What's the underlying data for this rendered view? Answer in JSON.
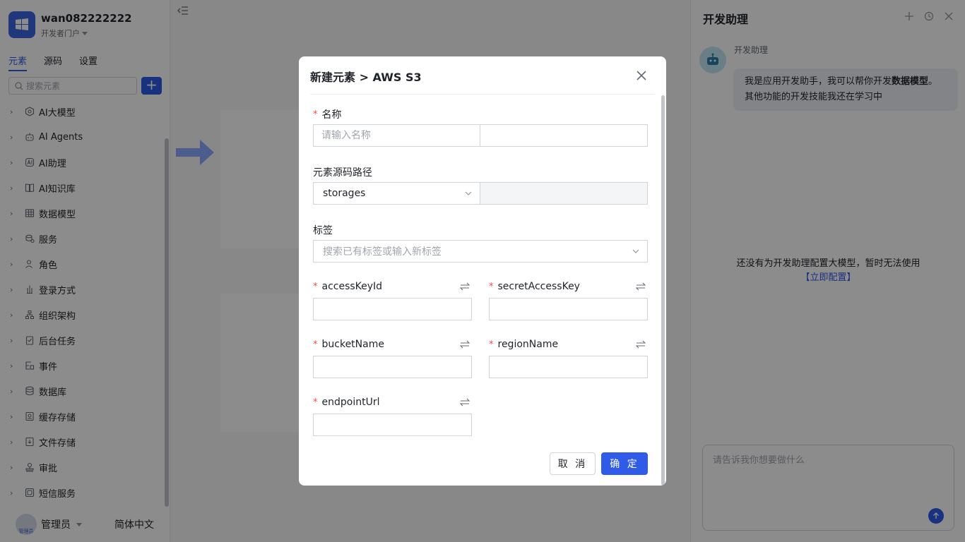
{
  "app": {
    "name": "wan082222222",
    "portal": "开发者门户"
  },
  "sidebar": {
    "tabs": [
      {
        "label": "元素",
        "active": true
      },
      {
        "label": "源码",
        "active": false
      },
      {
        "label": "设置",
        "active": false
      }
    ],
    "search_placeholder": "搜索元素",
    "add_label": "+",
    "items": [
      {
        "label": "AI大模型",
        "icon": "cube-icon"
      },
      {
        "label": "AI Agents",
        "icon": "robot-icon"
      },
      {
        "label": "AI助理",
        "icon": "ai-assistant-icon"
      },
      {
        "label": "AI知识库",
        "icon": "book-icon"
      },
      {
        "label": "数据模型",
        "icon": "table-icon"
      },
      {
        "label": "服务",
        "icon": "service-icon"
      },
      {
        "label": "角色",
        "icon": "role-icon"
      },
      {
        "label": "登录方式",
        "icon": "login-icon"
      },
      {
        "label": "组织架构",
        "icon": "org-icon"
      },
      {
        "label": "后台任务",
        "icon": "task-icon"
      },
      {
        "label": "事件",
        "icon": "event-icon"
      },
      {
        "label": "数据库",
        "icon": "database-icon"
      },
      {
        "label": "缓存存储",
        "icon": "cache-icon"
      },
      {
        "label": "文件存储",
        "icon": "file-storage-icon"
      },
      {
        "label": "审批",
        "icon": "approval-icon"
      },
      {
        "label": "短信服务",
        "icon": "sms-icon"
      }
    ],
    "footer": {
      "user": "管理员",
      "avatar_label": "管理员",
      "language": "简体中文"
    }
  },
  "assistant": {
    "title": "开发助理",
    "bot_name": "开发助理",
    "message_prefix": "我是应用开发助手，我可以帮你开发",
    "message_bold": "数据模型",
    "message_suffix": "。其他功能的开发技能我还在学习中",
    "empty_text": "还没有为开发助理配置大模型，暂时无法使用",
    "config_link": "【立即配置】",
    "input_placeholder": "请告诉我你想要做什么"
  },
  "modal": {
    "title": "新建元素 > AWS S3",
    "fields": {
      "name": {
        "label": "名称",
        "required": true,
        "placeholder": "请输入名称",
        "value": "",
        "secondary_value": ""
      },
      "path": {
        "label": "元素源码路径",
        "required": false,
        "value": "storages",
        "secondary_value": ""
      },
      "tags": {
        "label": "标签",
        "required": false,
        "placeholder": "搜索已有标签或输入新标签"
      },
      "accessKeyId": {
        "label": "accessKeyId",
        "required": true,
        "value": ""
      },
      "secretAccessKey": {
        "label": "secretAccessKey",
        "required": true,
        "value": ""
      },
      "bucketName": {
        "label": "bucketName",
        "required": true,
        "value": ""
      },
      "regionName": {
        "label": "regionName",
        "required": true,
        "value": ""
      },
      "endpointUrl": {
        "label": "endpointUrl",
        "required": true,
        "value": ""
      }
    },
    "cancel_label": "取 消",
    "ok_label": "确 定"
  },
  "colors": {
    "primary": "#2f5be8",
    "required": "#f54a45",
    "mask": "rgba(0,0,0,0.45)"
  }
}
